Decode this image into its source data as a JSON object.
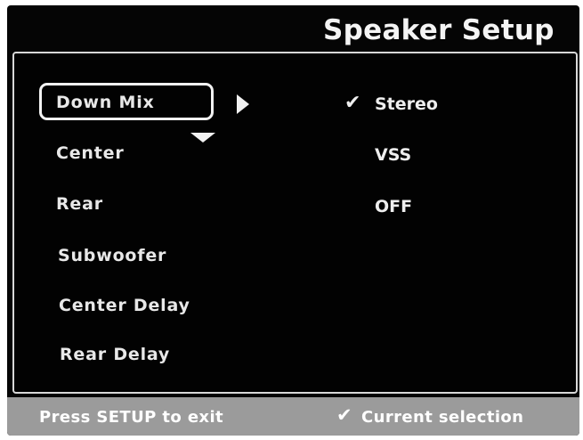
{
  "title": "Speaker Setup",
  "menu": {
    "items": [
      {
        "label": "Down Mix"
      },
      {
        "label": "Center"
      },
      {
        "label": "Rear"
      },
      {
        "label": "Subwoofer"
      },
      {
        "label": "Center Delay"
      },
      {
        "label": "Rear Delay"
      }
    ],
    "selected_index": 0
  },
  "options": {
    "items": [
      {
        "label": "Stereo",
        "current": true
      },
      {
        "label": "VSS",
        "current": false
      },
      {
        "label": "OFF",
        "current": false
      }
    ],
    "check_glyph": "✔"
  },
  "footer": {
    "exit_hint": "Press SETUP to exit",
    "legend_label": "Current selection"
  },
  "colors": {
    "background": "#050505",
    "text": "#eeeeee",
    "footer_bar": "#9b9b9b"
  }
}
